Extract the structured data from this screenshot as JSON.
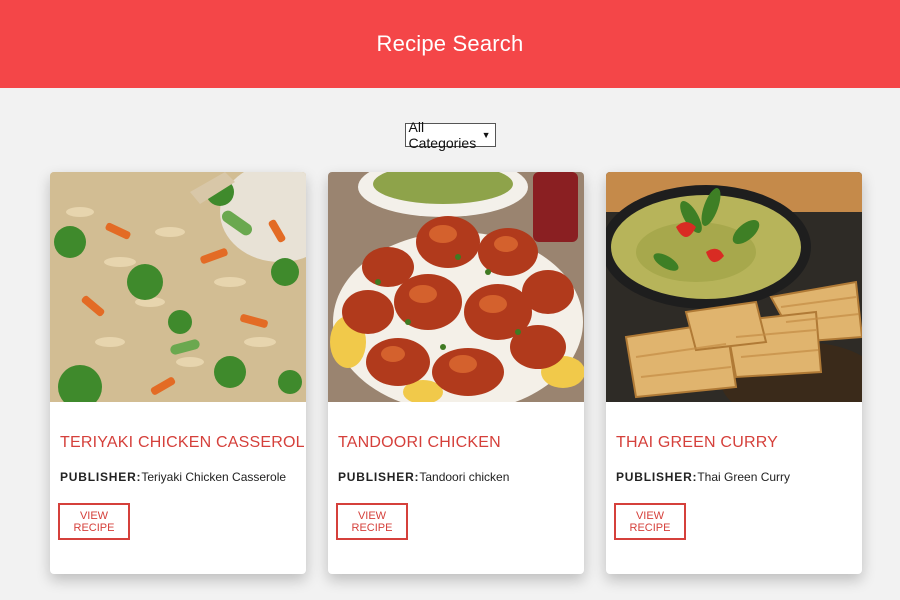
{
  "header": {
    "title": "Recipe Search"
  },
  "filter": {
    "selected": "All Categories"
  },
  "recipes": [
    {
      "title": "Teriyaki Chicken Casserol...",
      "publisher_label": "Publisher:",
      "publisher": "Teriyaki Chicken Casserole",
      "button": "View Recipe",
      "image": "fried-rice-with-vegetables"
    },
    {
      "title": "Tandoori chicken",
      "publisher_label": "Publisher:",
      "publisher": "Tandoori chicken",
      "button": "View Recipe",
      "image": "tandoori-chicken-platter"
    },
    {
      "title": "Thai Green Curry",
      "publisher_label": "Publisher:",
      "publisher": "Thai Green Curry",
      "button": "View Recipe",
      "image": "green-curry-with-flatbread"
    }
  ],
  "colors": {
    "header": "#f44648",
    "accent": "#d5403b",
    "background": "#f2f2f2"
  }
}
